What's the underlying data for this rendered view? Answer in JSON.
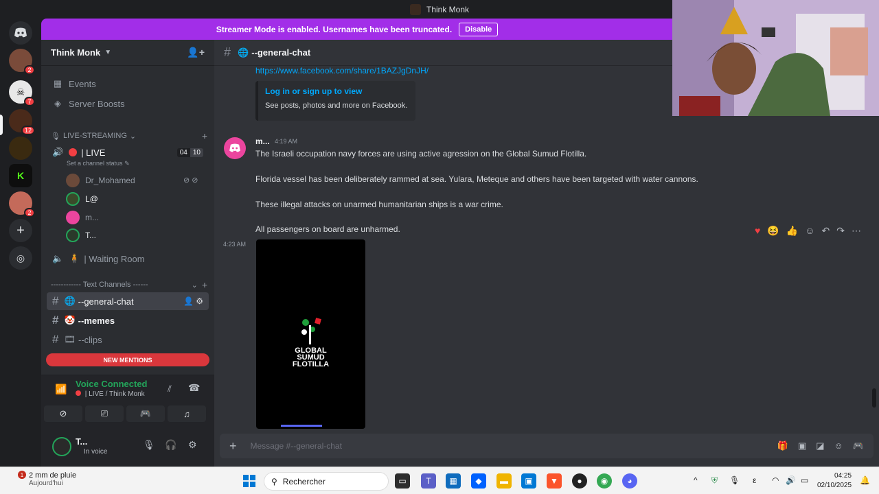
{
  "window": {
    "title": "Think Monk"
  },
  "banner": {
    "text": "Streamer Mode is enabled. Usernames have been truncated.",
    "button": "Disable"
  },
  "rail": {
    "badges": [
      "2",
      "7",
      "12",
      "2"
    ]
  },
  "server": {
    "name": "Think Monk"
  },
  "sidebar": {
    "events": "Events",
    "boosts": "Server Boosts",
    "category_live": "LIVE-STREAMING",
    "live_channel": "| LIVE",
    "live_counts": {
      "left": "04",
      "right": "10"
    },
    "channel_status": "Set a channel status",
    "voice_users": [
      "Dr_Mohamed",
      "L@",
      "m...",
      "T..."
    ],
    "waiting_room": "| Waiting Room",
    "category_text": "------------ Text Channels ------",
    "channels": [
      "--general-chat",
      "--memes",
      "--clips"
    ],
    "new_mentions": "NEW MENTIONS"
  },
  "voice_panel": {
    "title": "Voice Connected",
    "subtitle": "| LIVE / Think Monk"
  },
  "user_panel": {
    "name": "T...",
    "status": "In voice"
  },
  "chat": {
    "channel_name": "--general-chat",
    "link": "https://www.facebook.com/share/1BAZJgDnJH/",
    "embed_title": "Log in or sign up to view",
    "embed_desc": "See posts, photos and more on Facebook.",
    "author": "m...",
    "time": "4:19 AM",
    "lines": [
      "The Israeli occupation navy forces are using active agression on the Global Sumud Flotilla.",
      "Florida vessel has been deliberately rammed at sea. Yulara, Meteque and others have been targeted with water cannons.",
      "These illegal attacks on unarmed humanitarian ships is a war crime.",
      "All passengers on board are unharmed."
    ],
    "second_time": "4:23 AM",
    "video_text": [
      "GLOBAL",
      "SUMUD",
      "FLOTILLA"
    ],
    "composer_placeholder": "Message #--general-chat"
  },
  "taskbar": {
    "weather_main": "2 mm de pluie",
    "weather_sub": "Aujourd'hui",
    "weather_badge": "1",
    "search": "Rechercher",
    "time": "04:25",
    "date": "02/10/2025"
  }
}
